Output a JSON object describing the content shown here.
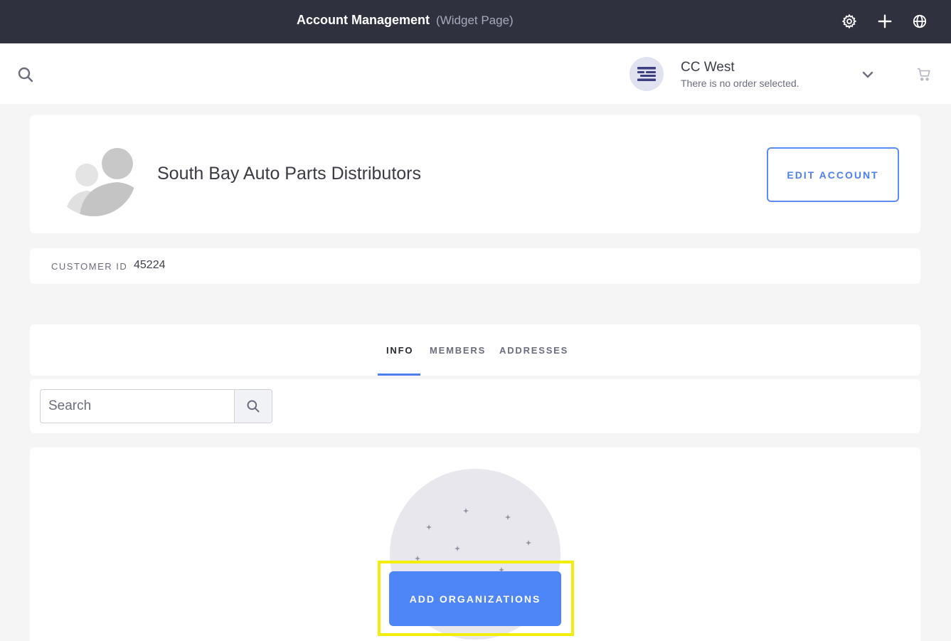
{
  "control_bar": {
    "title": "Account Management",
    "subtitle": "(Widget Page)",
    "icons": [
      "gear-icon",
      "plus-icon",
      "globe-icon"
    ]
  },
  "header": {
    "account_name": "CC West",
    "order_status": "There is no order selected.",
    "icons": [
      "search-icon",
      "chevron-down-icon",
      "cart-icon"
    ]
  },
  "profile": {
    "name": "South Bay Auto Parts Distributors",
    "edit_label": "EDIT ACCOUNT"
  },
  "customer": {
    "label": "CUSTOMER ID",
    "value": "45224"
  },
  "tabs": [
    {
      "label": "INFO",
      "active": true
    },
    {
      "label": "MEMBERS",
      "active": false
    },
    {
      "label": "ADDRESSES",
      "active": false
    }
  ],
  "search": {
    "placeholder": "Search"
  },
  "empty_state": {
    "button_label": "ADD ORGANIZATIONS"
  },
  "colors": {
    "accent": "#4f86f7",
    "topbar": "#30313f",
    "highlight": "#f2ee0a"
  }
}
